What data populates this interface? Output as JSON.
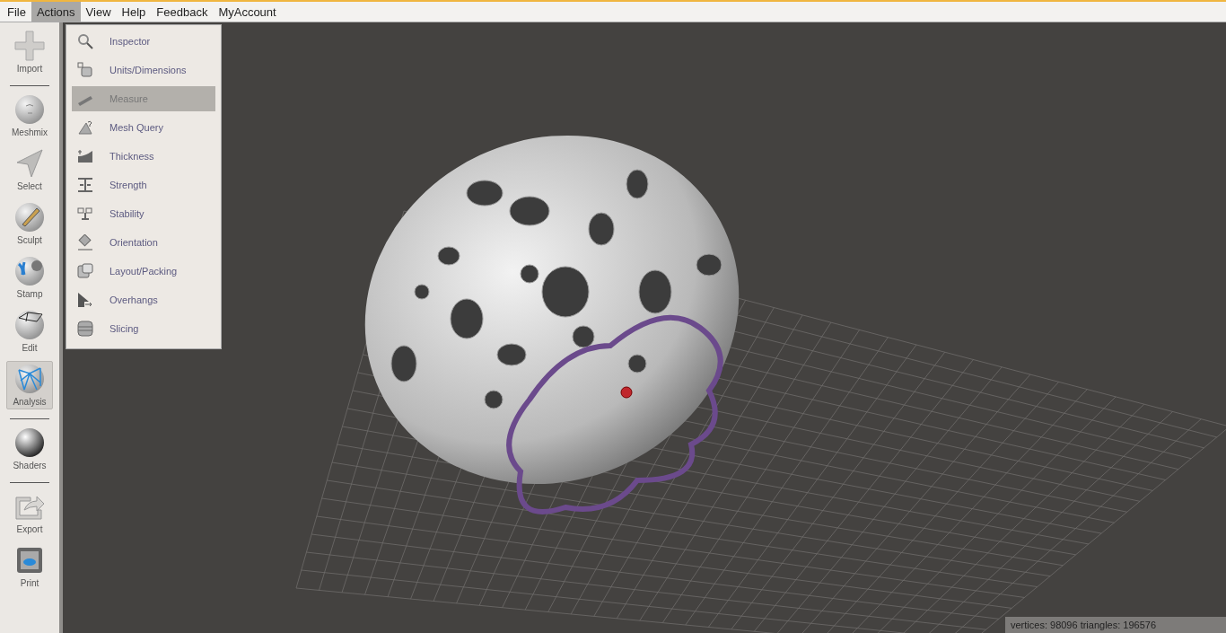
{
  "menu_bar": [
    {
      "label": "File",
      "selected": false
    },
    {
      "label": "Actions",
      "selected": true
    },
    {
      "label": "View",
      "selected": false
    },
    {
      "label": "Help",
      "selected": false
    },
    {
      "label": "Feedback",
      "selected": false
    },
    {
      "label": "MyAccount",
      "selected": false
    }
  ],
  "sidebar": {
    "groups": [
      [
        {
          "label": "Import",
          "selected": false
        }
      ],
      [
        {
          "label": "Meshmix",
          "selected": false
        },
        {
          "label": "Select",
          "selected": false
        },
        {
          "label": "Sculpt",
          "selected": false
        },
        {
          "label": "Stamp",
          "selected": false
        },
        {
          "label": "Edit",
          "selected": false
        },
        {
          "label": "Analysis",
          "selected": true
        }
      ],
      [
        {
          "label": "Shaders",
          "selected": false
        }
      ],
      [
        {
          "label": "Export",
          "selected": false
        },
        {
          "label": "Print",
          "selected": false
        }
      ]
    ]
  },
  "actions_menu": {
    "items": [
      {
        "label": "Inspector",
        "selected": false
      },
      {
        "label": "Units/Dimensions",
        "selected": false
      },
      {
        "label": "Measure",
        "selected": true
      },
      {
        "label": "Mesh Query",
        "selected": false
      },
      {
        "label": "Thickness",
        "selected": false
      },
      {
        "label": "Strength",
        "selected": false
      },
      {
        "label": "Stability",
        "selected": false
      },
      {
        "label": "Orientation",
        "selected": false
      },
      {
        "label": "Layout/Packing",
        "selected": false
      },
      {
        "label": "Overhangs",
        "selected": false
      },
      {
        "label": "Slicing",
        "selected": false
      }
    ]
  },
  "status_bar": "vertices: 98096 triangles: 196576"
}
